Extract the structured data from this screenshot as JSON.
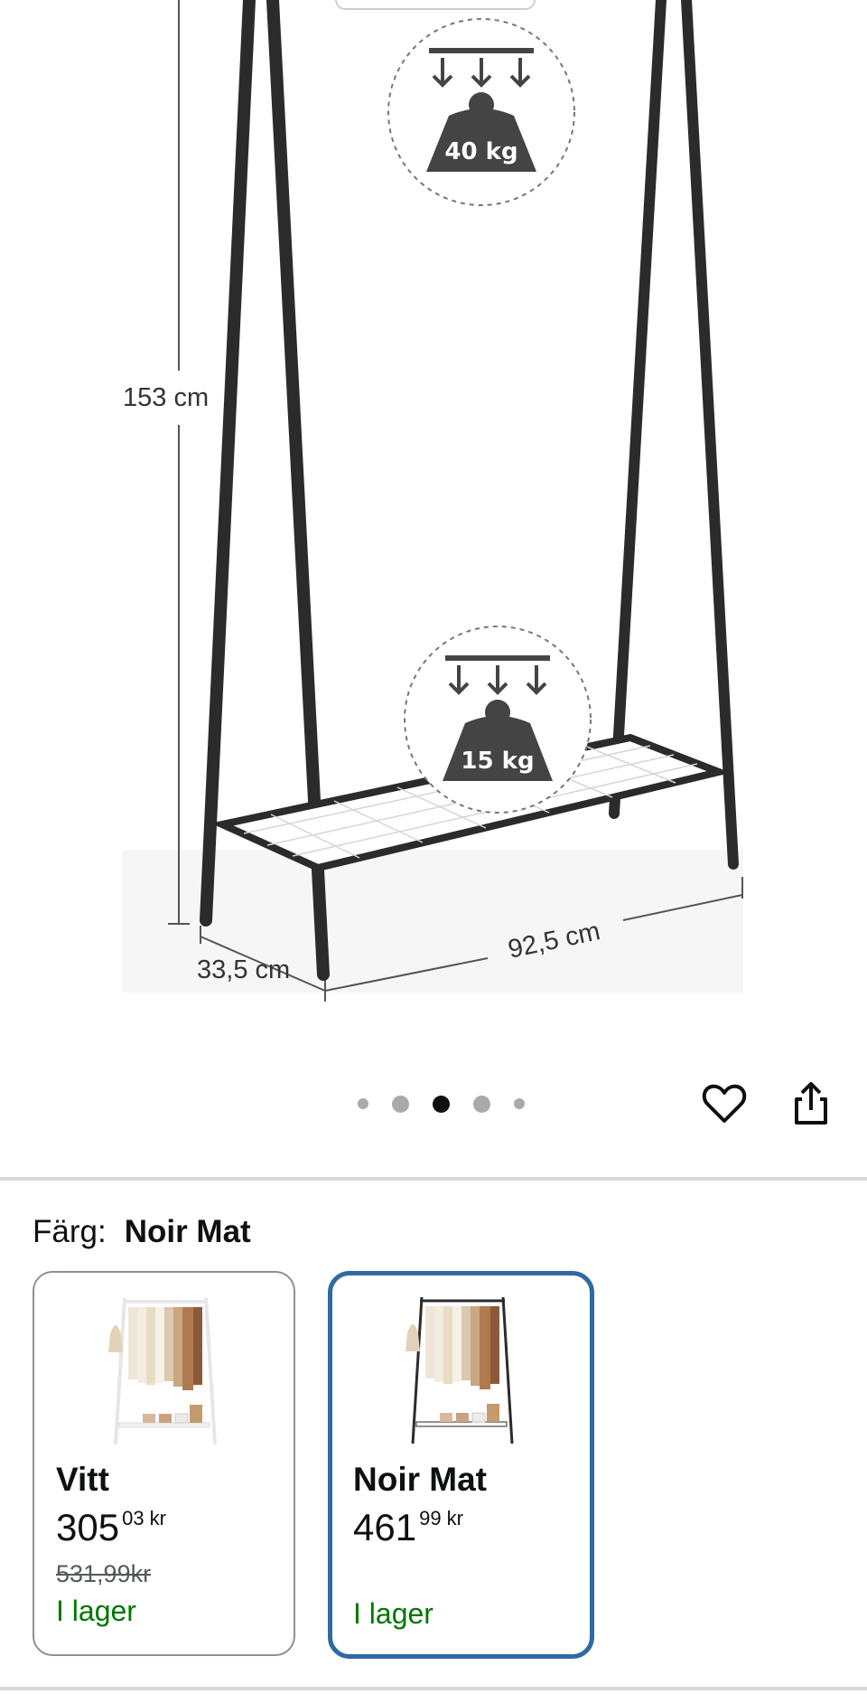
{
  "product_image": {
    "alt": "Klädställning med mått",
    "height_label": "153 cm",
    "depth_label": "33,5 cm",
    "width_label": "92,5 cm",
    "top_load": "40 kg",
    "shelf_load": "15 kg"
  },
  "carousel": {
    "total_images": 5,
    "active_index": 2
  },
  "actions": {
    "favorite_icon": "heart-icon",
    "share_icon": "share-icon"
  },
  "color": {
    "label": "Färg:",
    "selected": "Noir Mat"
  },
  "variants": [
    {
      "name": "Vitt",
      "price_whole": "305",
      "price_fraction": "03",
      "currency": "kr",
      "list_price": "531,99kr",
      "availability": "I lager",
      "frame_color": "#f2f2f2",
      "selected": false
    },
    {
      "name": "Noir Mat",
      "price_whole": "461",
      "price_fraction": "99",
      "currency": "kr",
      "availability": "I lager",
      "frame_color": "#2b2b2b",
      "selected": true
    }
  ],
  "colors": {
    "selected_border": "#2f6aa3",
    "in_stock": "#007600",
    "text": "#0f1111"
  }
}
